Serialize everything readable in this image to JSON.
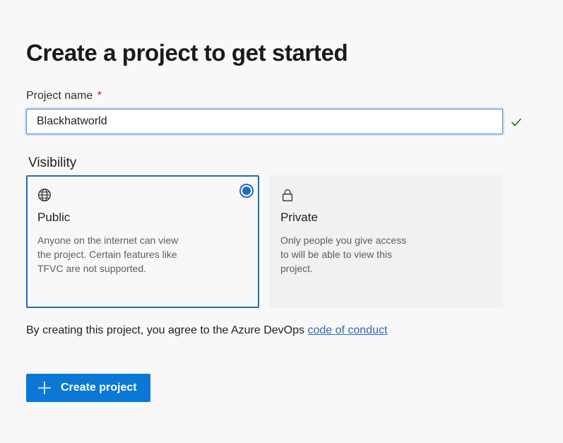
{
  "form": {
    "title": "Create a project to get started",
    "project_name_label": "Project name",
    "required_marker": "*",
    "project_name_value": "Blackhatworld",
    "visibility_label": "Visibility"
  },
  "visibility": {
    "selected": "public",
    "options": [
      {
        "id": "public",
        "icon": "globe-icon",
        "title": "Public",
        "description": "Anyone on the internet can view the project. Certain features like TFVC are not supported."
      },
      {
        "id": "private",
        "icon": "lock-icon",
        "title": "Private",
        "description": "Only people you give access to will be able to view this project."
      }
    ]
  },
  "agreement": {
    "text": "By creating this project, you agree to the Azure DevOps",
    "link_text": "code of conduct"
  },
  "actions": {
    "create_label": "Create project",
    "create_icon": "plus-icon"
  },
  "colors": {
    "accent": "#0a78d4",
    "selected_border": "#1f6eb8",
    "valid_check": "#107c10",
    "required": "#a4262c",
    "link": "#2b6cb0"
  }
}
